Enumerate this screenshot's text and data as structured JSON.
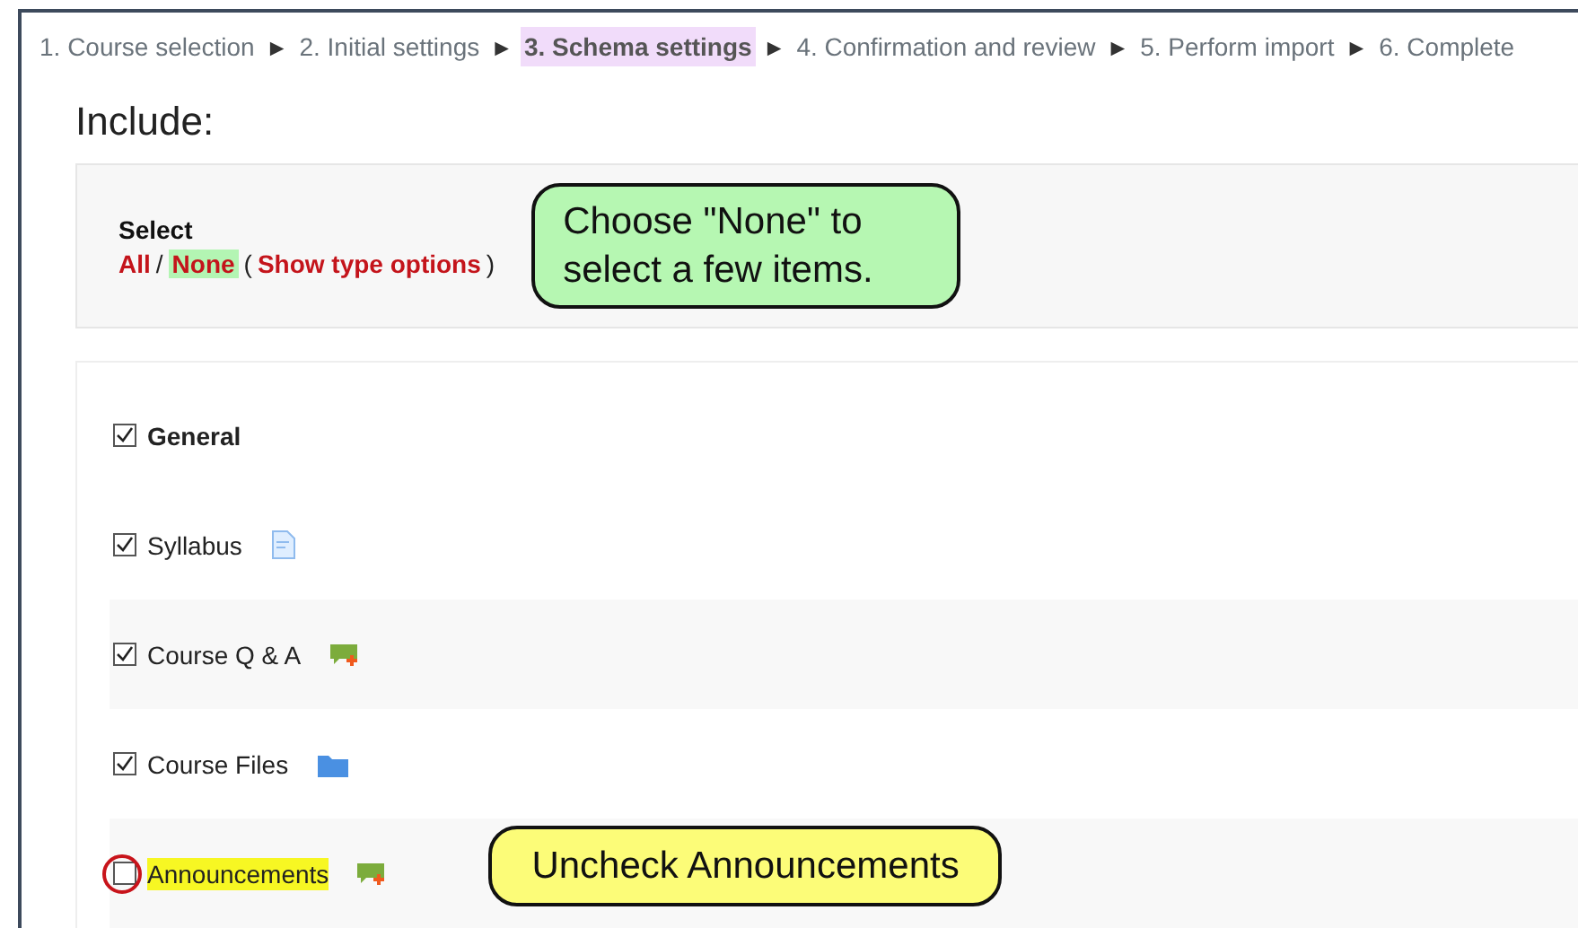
{
  "steps": [
    {
      "label": "1. Course selection",
      "selected": false
    },
    {
      "label": "2. Initial settings",
      "selected": false
    },
    {
      "label": "3. Schema settings",
      "selected": true
    },
    {
      "label": "4. Confirmation and review",
      "selected": false
    },
    {
      "label": "5. Perform import",
      "selected": false
    },
    {
      "label": "6. Complete",
      "selected": false
    }
  ],
  "separator": "►",
  "heading": "Include:",
  "select": {
    "title": "Select",
    "links": [
      {
        "label": "All",
        "highlighted": false
      },
      {
        "label": "None",
        "highlighted": true
      }
    ],
    "slash": "/",
    "open_paren": "(",
    "close_paren": ")",
    "type_link": "Show type options",
    "callout": "Choose \"None\" to select a few items."
  },
  "items": [
    {
      "label": "General",
      "kind": "section",
      "checked": true,
      "highlighted": false
    },
    {
      "label": "Syllabus",
      "kind": "page",
      "checked": true,
      "highlighted": false
    },
    {
      "label": "Course Q & A",
      "kind": "forum",
      "checked": true,
      "highlighted": false
    },
    {
      "label": "Course Files",
      "kind": "folder",
      "checked": true,
      "highlighted": false
    },
    {
      "label": "Announcements",
      "kind": "forum",
      "checked": false,
      "highlighted": true,
      "callout": "Uncheck Announcements"
    }
  ]
}
